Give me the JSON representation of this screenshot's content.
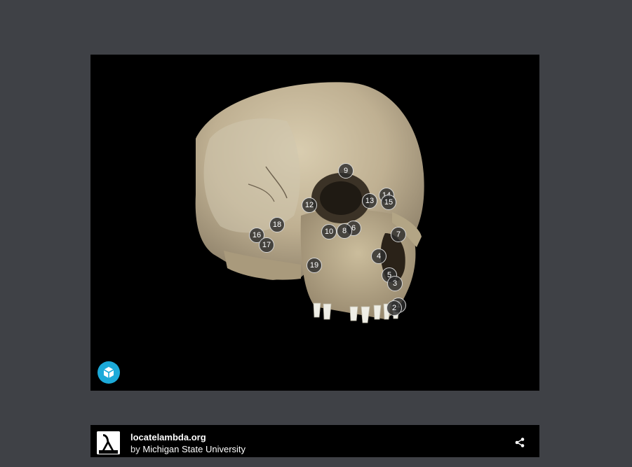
{
  "viewer": {
    "hotspots": [
      {
        "label": "9"
      },
      {
        "label": "14"
      },
      {
        "label": "13"
      },
      {
        "label": "15"
      },
      {
        "label": "12"
      },
      {
        "label": "18"
      },
      {
        "label": "16"
      },
      {
        "label": "17"
      },
      {
        "label": "10"
      },
      {
        "label": "8"
      },
      {
        "label": "6"
      },
      {
        "label": "7"
      },
      {
        "label": "4"
      },
      {
        "label": "19"
      },
      {
        "label": "5"
      },
      {
        "label": "3"
      },
      {
        "label": "2"
      },
      {
        "label": "1"
      }
    ],
    "logo_icon": "sketchfab-cube-icon",
    "logo_color": "#1caad9"
  },
  "footer": {
    "title": "locatelambda.org",
    "by_prefix": "by",
    "author": "Michigan State University",
    "avatar_icon": "lambda-logo-icon",
    "avatar_text": "LAMBDA",
    "share_icon": "share-icon"
  }
}
